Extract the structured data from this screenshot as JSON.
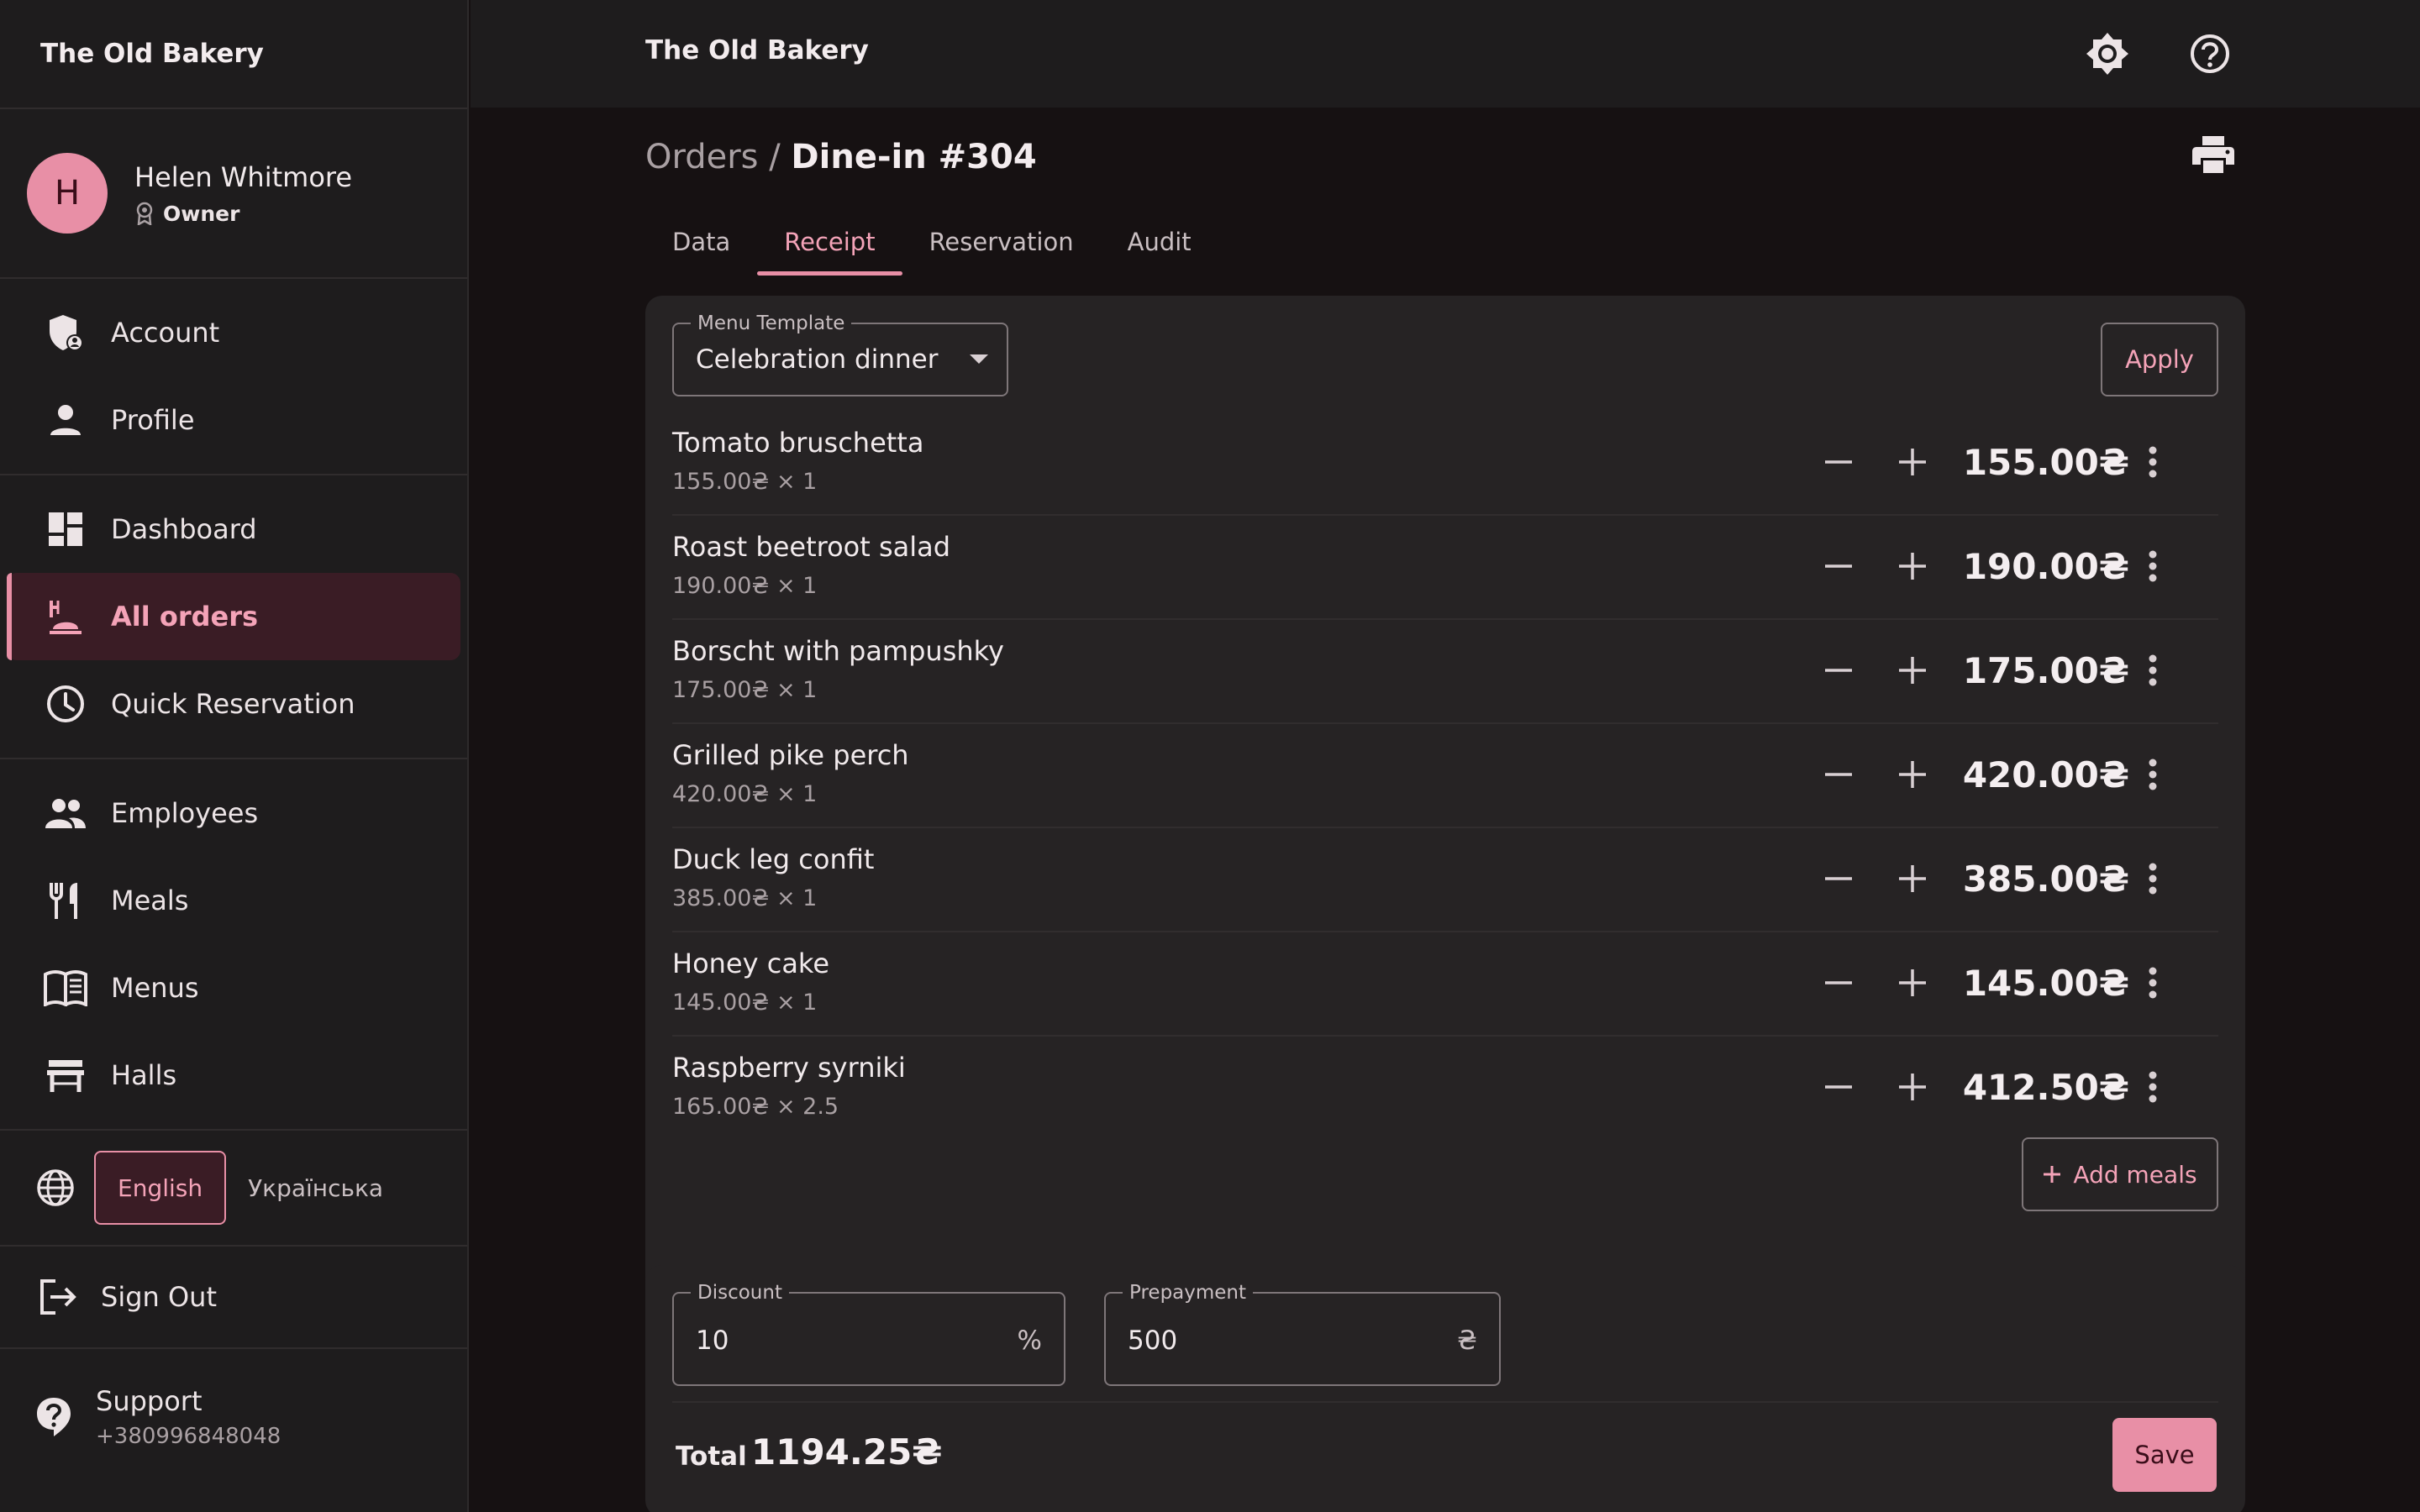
{
  "app": {
    "title": "The Old Bakery"
  },
  "user": {
    "initial": "H",
    "name": "Helen Whitmore",
    "role": "Owner"
  },
  "sidebar": {
    "groups": [
      [
        {
          "label": "Account",
          "icon": "account-shield-icon"
        },
        {
          "label": "Profile",
          "icon": "person-icon"
        }
      ],
      [
        {
          "label": "Dashboard",
          "icon": "dashboard-icon"
        },
        {
          "label": "All orders",
          "icon": "orders-icon",
          "active": true
        },
        {
          "label": "Quick Reservation",
          "icon": "clock-icon"
        }
      ],
      [
        {
          "label": "Employees",
          "icon": "people-icon"
        },
        {
          "label": "Meals",
          "icon": "fork-knife-icon"
        },
        {
          "label": "Menus",
          "icon": "book-icon"
        },
        {
          "label": "Halls",
          "icon": "table-icon"
        }
      ]
    ],
    "languages": {
      "active": "English",
      "other": "Українська"
    },
    "sign_out": "Sign Out",
    "support": {
      "title": "Support",
      "phone": "+380996848048"
    }
  },
  "breadcrumb": {
    "parent": "Orders",
    "separator": " / ",
    "current": "Dine-in #304"
  },
  "tabs": [
    "Data",
    "Receipt",
    "Reservation",
    "Audit"
  ],
  "active_tab": "Receipt",
  "receipt": {
    "template_label": "Menu Template",
    "template_value": "Celebration dinner",
    "apply_label": "Apply",
    "items": [
      {
        "name": "Tomato bruschetta",
        "qty": "155.00₴ × 1",
        "total": "155.00₴"
      },
      {
        "name": "Roast beetroot salad",
        "qty": "190.00₴ × 1",
        "total": "190.00₴"
      },
      {
        "name": "Borscht with pampushky",
        "qty": "175.00₴ × 1",
        "total": "175.00₴"
      },
      {
        "name": "Grilled pike perch",
        "qty": "420.00₴ × 1",
        "total": "420.00₴"
      },
      {
        "name": "Duck leg confit",
        "qty": "385.00₴ × 1",
        "total": "385.00₴"
      },
      {
        "name": "Honey cake",
        "qty": "145.00₴ × 1",
        "total": "145.00₴"
      },
      {
        "name": "Raspberry syrniki",
        "qty": "165.00₴ × 2.5",
        "total": "412.50₴"
      }
    ],
    "add_meals_label": "Add meals"
  },
  "summary": {
    "discount_label": "Discount",
    "discount_value": "10",
    "discount_suffix": "%",
    "prepayment_label": "Prepayment",
    "prepayment_value": "500",
    "prepayment_suffix": "₴",
    "total_label": "Total",
    "total_value": "1194.25₴",
    "save_label": "Save"
  },
  "colors": {
    "accent": "#e88fa6",
    "background": "#161112",
    "surface": "#262324",
    "sidebar": "#1e1c1d"
  }
}
